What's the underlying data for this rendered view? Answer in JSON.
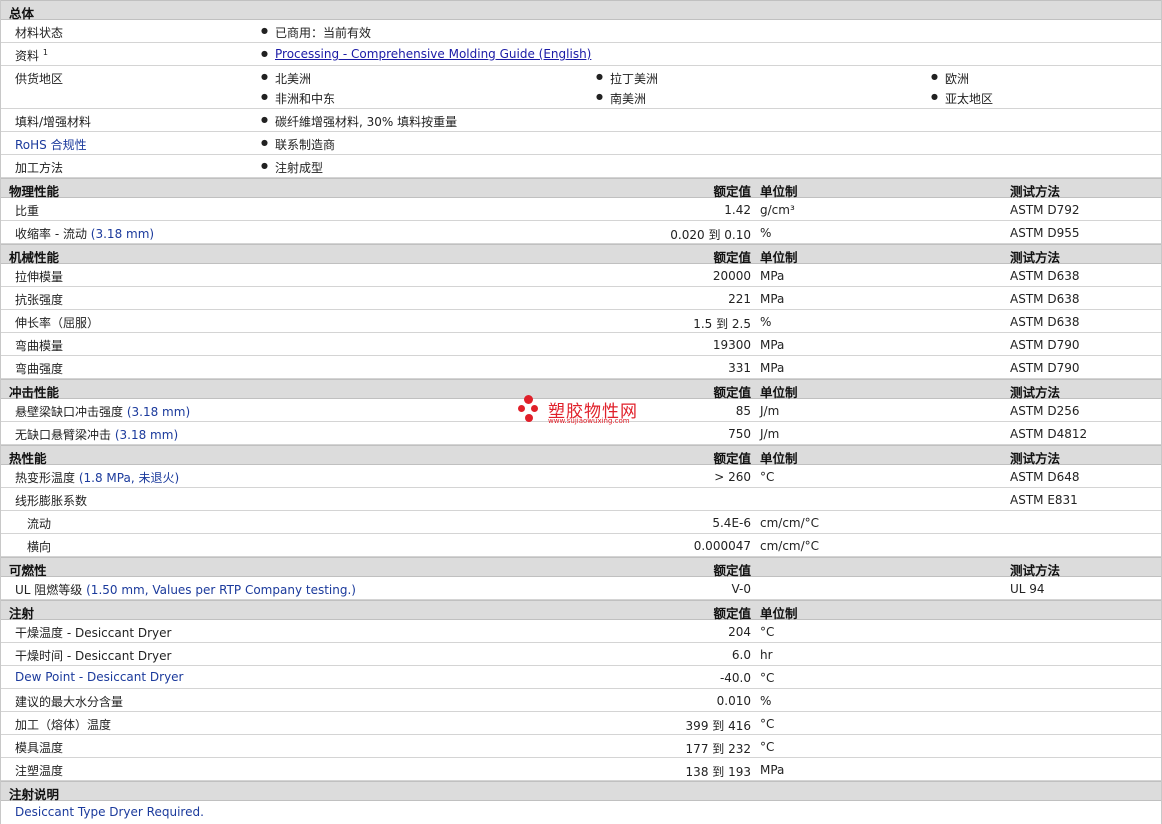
{
  "general": {
    "title": "总体",
    "rows": [
      {
        "label": "材料状态",
        "values": [
          "已商用：当前有效"
        ]
      },
      {
        "label": "资料",
        "sup": "1",
        "link": "Processing - Comprehensive Molding Guide (English)"
      },
      {
        "label": "供货地区",
        "values": [
          "北美洲",
          "拉丁美洲",
          "欧洲",
          "非洲和中东",
          "南美洲",
          "亚太地区"
        ]
      },
      {
        "label": "填料/增强材料",
        "values": [
          "碳纤維增强材料, 30% 填料按重量"
        ]
      },
      {
        "label": "RoHS 合规性",
        "values": [
          "联系制造商"
        ]
      },
      {
        "label": "加工方法",
        "values": [
          "注射成型"
        ]
      }
    ]
  },
  "columns": {
    "value": "额定值",
    "unit": "单位制",
    "method": "测试方法"
  },
  "physical": {
    "title": "物理性能",
    "rows": [
      {
        "label": "比重",
        "value": "1.42",
        "unit": "g/cm³",
        "method": "ASTM D792"
      },
      {
        "label": "收缩率  - 流动",
        "note": "(3.18 mm)",
        "value": "0.020 到  0.10",
        "unit": "%",
        "method": "ASTM D955"
      }
    ]
  },
  "mechanical": {
    "title": "机械性能",
    "rows": [
      {
        "label": "拉伸模量",
        "value": "20000",
        "unit": "MPa",
        "method": "ASTM D638"
      },
      {
        "label": "抗张强度",
        "value": "221",
        "unit": "MPa",
        "method": "ASTM D638"
      },
      {
        "label": "伸长率（屈服）",
        "value": "1.5 到  2.5",
        "unit": "%",
        "method": "ASTM D638"
      },
      {
        "label": "弯曲模量",
        "value": "19300",
        "unit": "MPa",
        "method": "ASTM D790"
      },
      {
        "label": "弯曲强度",
        "value": "331",
        "unit": "MPa",
        "method": "ASTM D790"
      }
    ]
  },
  "impact": {
    "title": "冲击性能",
    "rows": [
      {
        "label": "悬壁梁缺口冲击强度",
        "note": "(3.18 mm)",
        "value": "85",
        "unit": "J/m",
        "method": "ASTM D256"
      },
      {
        "label": "无缺口悬臂梁冲击",
        "note": "(3.18 mm)",
        "value": "750",
        "unit": "J/m",
        "method": "ASTM D4812"
      }
    ]
  },
  "thermal": {
    "title": "热性能",
    "rows": [
      {
        "label": "热变形温度",
        "note": "(1.8 MPa, 未退火)",
        "value": "> 260",
        "unit": "°C",
        "method": "ASTM D648"
      },
      {
        "label": "线形膨胀系数",
        "value": "",
        "unit": "",
        "method": "ASTM E831"
      },
      {
        "label": "流动",
        "sub": true,
        "value": "5.4E-6",
        "unit": "cm/cm/°C",
        "method": ""
      },
      {
        "label": "横向",
        "sub": true,
        "value": "0.000047",
        "unit": "cm/cm/°C",
        "method": ""
      }
    ]
  },
  "flammability": {
    "title": "可燃性",
    "rows": [
      {
        "label": "UL 阻燃等级",
        "note": "(1.50 mm, Values per RTP Company testing.)",
        "value": "V-0",
        "unit": "",
        "method": "UL 94"
      }
    ]
  },
  "injection": {
    "title": "注射",
    "rows": [
      {
        "label": "干燥温度  - Desiccant Dryer",
        "value": "204",
        "unit": "°C"
      },
      {
        "label": "干燥时间  - Desiccant Dryer",
        "value": "6.0",
        "unit": "hr"
      },
      {
        "label": "Dew Point - Desiccant Dryer",
        "value": "-40.0",
        "unit": "°C"
      },
      {
        "label": "建议的最大水分含量",
        "value": "0.010",
        "unit": "%"
      },
      {
        "label": "加工（熔体）温度",
        "value": "399 到  416",
        "unit": "°C"
      },
      {
        "label": "模具温度",
        "value": "177 到  232",
        "unit": "°C"
      },
      {
        "label": "注塑温度",
        "value": "138 到  193",
        "unit": "MPa"
      }
    ]
  },
  "notes": {
    "title": "注射说明",
    "text": "Desiccant Type Dryer Required."
  },
  "watermark": {
    "name": "塑胶物性网",
    "url": "www.sujiaowuxing.com",
    "color": "#e0202a"
  }
}
